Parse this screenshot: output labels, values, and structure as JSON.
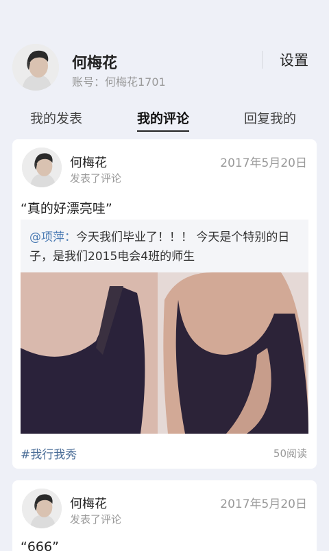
{
  "profile": {
    "name": "何梅花",
    "account": "账号：何梅花1701",
    "settings_label": "设置"
  },
  "tabs": [
    {
      "label": "我的发表",
      "active": false
    },
    {
      "label": "我的评论",
      "active": true
    },
    {
      "label": "回复我的",
      "active": false
    }
  ],
  "posts": [
    {
      "author": "何梅花",
      "action": "发表了评论",
      "date": "2017年5月20日",
      "comment": "“真的好漂亮哇”",
      "quote_mention": "@项萍：",
      "quote_text": "今天我们毕业了！！！ 今天是个特别的日子，是我们2015电会4班的师生",
      "hashtag": "#我行我秀",
      "reads": "50阅读"
    },
    {
      "author": "何梅花",
      "action": "发表了评论",
      "date": "2017年5月20日",
      "comment": "“666”"
    }
  ],
  "colors": {
    "background": "#eef0f7",
    "link": "#4a7ab3",
    "hashtag": "#4a6d97",
    "muted": "#999999"
  },
  "icons": {
    "avatar": "user-avatar-photo"
  }
}
